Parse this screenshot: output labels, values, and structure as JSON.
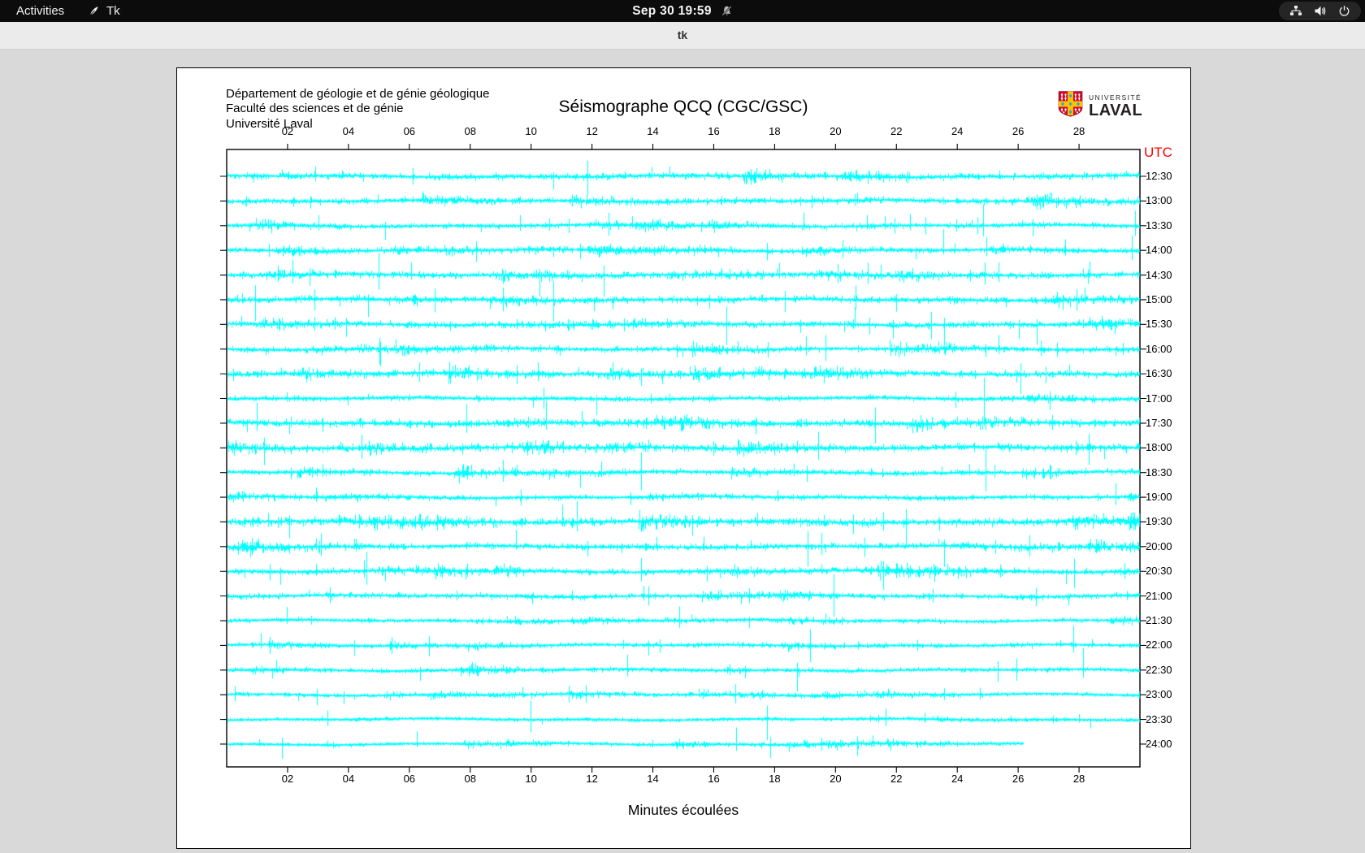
{
  "top_bar": {
    "activities_label": "Activities",
    "app_name": "Tk",
    "clock": "Sep 30 19:59",
    "status_icons": [
      "network-icon",
      "volume-icon",
      "power-icon"
    ],
    "notification_icon": "notifications-muted-icon"
  },
  "window": {
    "title": "tk",
    "controls": [
      "minimize",
      "maximize",
      "close"
    ]
  },
  "seismograph": {
    "header_lines": [
      "Département de géologie et de génie géologique",
      "Faculté des sciences et de génie",
      "Université Laval"
    ],
    "logo": {
      "line1": "UNIVERSITÉ",
      "line2": "LAVAL",
      "shield_red": "#cf0a2c",
      "shield_gold": "#ffc103",
      "shield_blue": "#1fa8df"
    }
  },
  "chart_data": {
    "type": "line",
    "subtype": "helicorder-seismogram",
    "title": "Séismographe QCQ (CGC/GSC)",
    "xlabel": "Minutes écoulées",
    "right_axis_label": "UTC",
    "right_axis_color": "#ff0000",
    "trace_color": "#00FFFF",
    "x_range_minutes": [
      0,
      30
    ],
    "x_ticks": [
      "02",
      "04",
      "06",
      "08",
      "10",
      "12",
      "14",
      "16",
      "18",
      "20",
      "22",
      "24",
      "26",
      "28"
    ],
    "grid": false,
    "rows": [
      {
        "utc": "12:30",
        "amp": 1.8,
        "end_minute": 30
      },
      {
        "utc": "13:00",
        "amp": 1.7,
        "end_minute": 30
      },
      {
        "utc": "13:30",
        "amp": 1.45,
        "end_minute": 30
      },
      {
        "utc": "14:00",
        "amp": 1.35,
        "end_minute": 30
      },
      {
        "utc": "14:30",
        "amp": 1.7,
        "end_minute": 30
      },
      {
        "utc": "15:00",
        "amp": 1.8,
        "end_minute": 30
      },
      {
        "utc": "15:30",
        "amp": 1.7,
        "end_minute": 30
      },
      {
        "utc": "16:00",
        "amp": 1.5,
        "end_minute": 30
      },
      {
        "utc": "16:30",
        "amp": 1.9,
        "end_minute": 30
      },
      {
        "utc": "17:00",
        "amp": 1.45,
        "end_minute": 30
      },
      {
        "utc": "17:30",
        "amp": 2.1,
        "end_minute": 30
      },
      {
        "utc": "18:00",
        "amp": 2.0,
        "end_minute": 30
      },
      {
        "utc": "18:30",
        "amp": 1.5,
        "end_minute": 30
      },
      {
        "utc": "19:00",
        "amp": 1.35,
        "end_minute": 30
      },
      {
        "utc": "19:30",
        "amp": 2.2,
        "end_minute": 30
      },
      {
        "utc": "20:00",
        "amp": 1.7,
        "end_minute": 30
      },
      {
        "utc": "20:30",
        "amp": 1.6,
        "end_minute": 30
      },
      {
        "utc": "21:00",
        "amp": 1.5,
        "end_minute": 30
      },
      {
        "utc": "21:30",
        "amp": 1.15,
        "end_minute": 30
      },
      {
        "utc": "22:00",
        "amp": 1.1,
        "end_minute": 30
      },
      {
        "utc": "22:30",
        "amp": 1.2,
        "end_minute": 30
      },
      {
        "utc": "23:00",
        "amp": 1.05,
        "end_minute": 30
      },
      {
        "utc": "23:30",
        "amp": 1.0,
        "end_minute": 30
      },
      {
        "utc": "24:00",
        "amp": 1.0,
        "end_minute": 26.2
      }
    ]
  }
}
